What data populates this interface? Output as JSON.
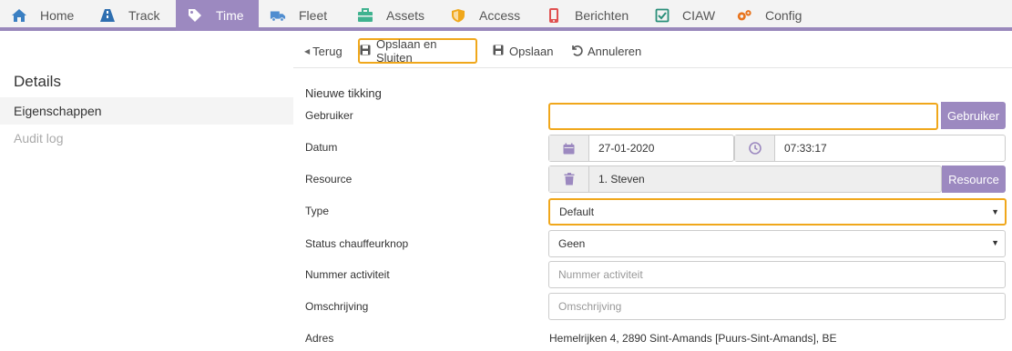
{
  "nav": [
    {
      "label": "Home",
      "icon": "home-icon",
      "active": false
    },
    {
      "label": "Track",
      "icon": "road-icon",
      "active": false
    },
    {
      "label": "Time",
      "icon": "tag-icon",
      "active": true
    },
    {
      "label": "Fleet",
      "icon": "truck-icon",
      "active": false
    },
    {
      "label": "Assets",
      "icon": "briefcase-icon",
      "active": false
    },
    {
      "label": "Access",
      "icon": "shield-icon",
      "active": false
    },
    {
      "label": "Berichten",
      "icon": "mobile-icon",
      "active": false
    },
    {
      "label": "CIAW",
      "icon": "checkbox-icon",
      "active": false
    },
    {
      "label": "Config",
      "icon": "cogs-icon",
      "active": false
    }
  ],
  "toolbar": {
    "back": "Terug",
    "save_close": "Opslaan en Sluiten",
    "save": "Opslaan",
    "cancel": "Annuleren"
  },
  "sidebar": {
    "title": "Details",
    "items": [
      {
        "label": "Eigenschappen",
        "active": true
      },
      {
        "label": "Audit log",
        "active": false
      }
    ]
  },
  "form": {
    "section_title": "Nieuwe tikking",
    "gebruiker": {
      "label": "Gebruiker",
      "value": "",
      "button": "Gebruiker"
    },
    "datum": {
      "label": "Datum",
      "date": "27-01-2020",
      "time": "07:33:17"
    },
    "resource": {
      "label": "Resource",
      "value": "1. Steven",
      "button": "Resource"
    },
    "type": {
      "label": "Type",
      "value": "Default"
    },
    "status": {
      "label": "Status chauffeurknop",
      "value": "Geen"
    },
    "nummer": {
      "label": "Nummer activiteit",
      "placeholder": "Nummer activiteit"
    },
    "omschrijving": {
      "label": "Omschrijving",
      "placeholder": "Omschrijving"
    },
    "adres": {
      "label": "Adres",
      "value": "Hemelrijken 4, 2890 Sint-Amands [Puurs-Sint-Amands], BE"
    }
  },
  "colors": {
    "accent": "#9c89c0",
    "highlight": "#f0a71b",
    "icon_blue": "#3a7fc2",
    "icon_orange": "#f0a71b",
    "icon_green": "#3fb28f",
    "icon_red": "#e05050"
  }
}
